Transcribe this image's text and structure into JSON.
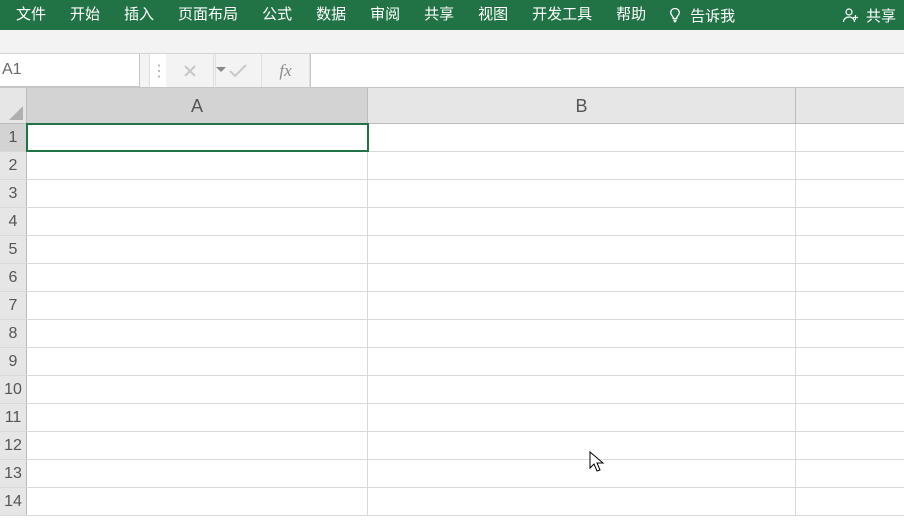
{
  "ribbon": {
    "tabs": [
      "文件",
      "开始",
      "插入",
      "页面布局",
      "公式",
      "数据",
      "审阅",
      "共享",
      "视图",
      "开发工具",
      "帮助"
    ],
    "tellme_label": "告诉我",
    "share_label": "共享"
  },
  "formula_bar": {
    "name_box_value": "A1",
    "fx_label": "fx",
    "formula_value": ""
  },
  "grid": {
    "columns": [
      "A",
      "B"
    ],
    "rows": [
      "1",
      "2",
      "3",
      "4",
      "5",
      "6",
      "7",
      "8",
      "9",
      "10",
      "11",
      "12",
      "13",
      "14"
    ],
    "cells": {}
  },
  "colors": {
    "accent": "#217346"
  }
}
